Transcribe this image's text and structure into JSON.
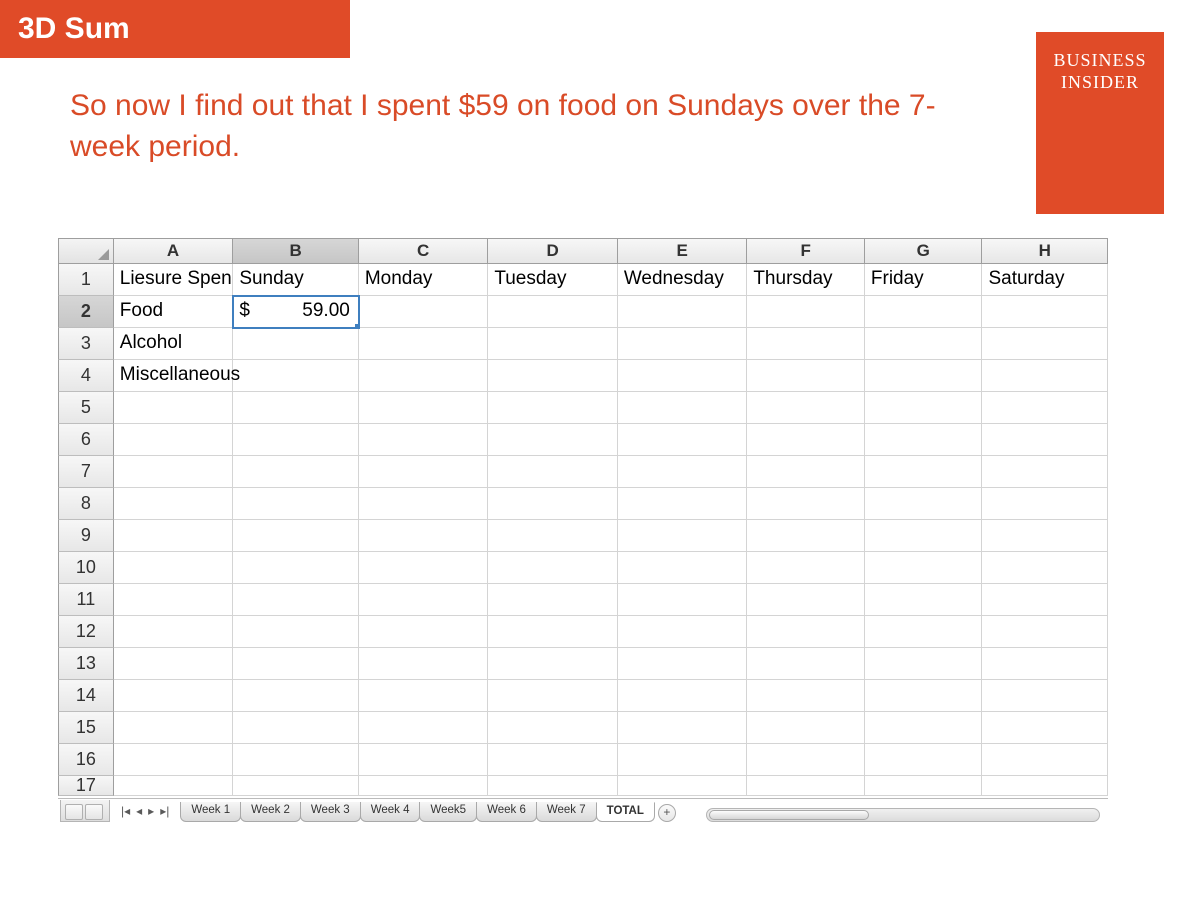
{
  "slide": {
    "title": "3D Sum",
    "description": "So now I find out that I spent $59 on food on Sundays over the 7-week period.",
    "brand_line1": "BUSINESS",
    "brand_line2": "INSIDER"
  },
  "spreadsheet": {
    "column_letters": [
      "A",
      "B",
      "C",
      "D",
      "E",
      "F",
      "G",
      "H"
    ],
    "selected_column": "B",
    "row_numbers": [
      "1",
      "2",
      "3",
      "4",
      "5",
      "6",
      "7",
      "8",
      "9",
      "10",
      "11",
      "12",
      "13",
      "14",
      "15",
      "16",
      "17"
    ],
    "selected_row": "2",
    "cells": {
      "A1": "Liesure Spen",
      "B1": "Sunday",
      "C1": "Monday",
      "D1": "Tuesday",
      "E1": "Wednesday",
      "F1": "Thursday",
      "G1": "Friday",
      "H1": "Saturday",
      "A2": "Food",
      "B2_currency": "$",
      "B2_value": "59.00",
      "A3": "Alcohol",
      "A4": "Miscellaneous"
    },
    "selected_cell": "B2"
  },
  "tabs": {
    "sheets": [
      "Week 1",
      "Week 2",
      "Week 3",
      "Week 4",
      "Week5",
      "Week 6",
      "Week 7",
      "TOTAL"
    ],
    "active": "TOTAL",
    "nav_first": "|◀◀",
    "nav_prev": "◀",
    "nav_next": "▶",
    "nav_last": "▶▶|",
    "add_label": "+"
  }
}
